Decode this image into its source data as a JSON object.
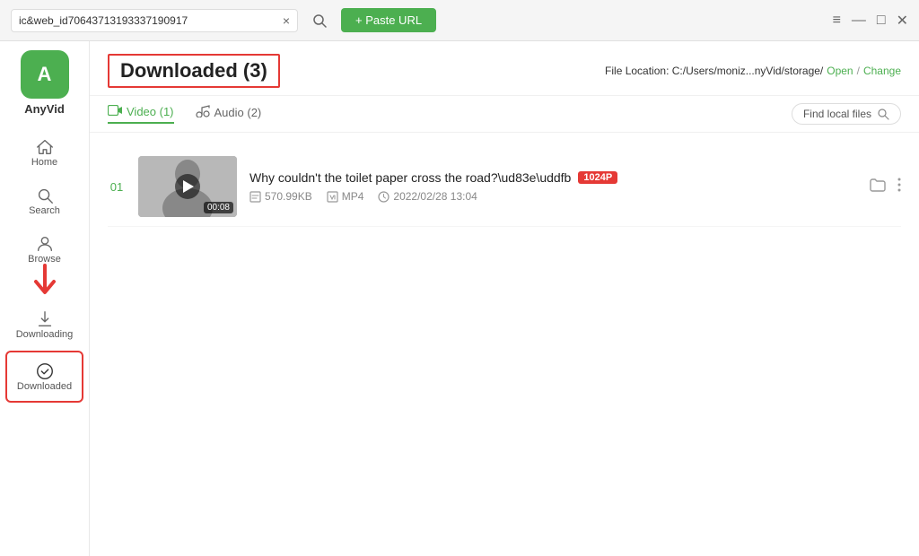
{
  "titlebar": {
    "tab_text": "ic&web_id70643713193337190917",
    "close_icon": "×",
    "search_icon": "⌕",
    "paste_url_label": "+ Paste URL",
    "window_menu": "≡",
    "window_minimize": "—",
    "window_maximize": "□",
    "window_close": "✕"
  },
  "sidebar": {
    "logo_text": "A",
    "app_name": "AnyVid",
    "items": [
      {
        "id": "home",
        "label": "Home",
        "icon": "home"
      },
      {
        "id": "search",
        "label": "Search",
        "icon": "search"
      },
      {
        "id": "browse",
        "label": "Browse",
        "icon": "browse"
      },
      {
        "id": "downloading",
        "label": "Downloading",
        "icon": "downloading"
      },
      {
        "id": "downloaded",
        "label": "Downloaded",
        "icon": "downloaded",
        "active": true
      }
    ]
  },
  "content": {
    "title": "Downloaded (3)",
    "file_location_label": "File Location: C:/Users/moniz...nyVid/storage/",
    "open_label": "Open",
    "separator": "/",
    "change_label": "Change",
    "tabs": [
      {
        "id": "video",
        "label": "Video (1)",
        "active": true
      },
      {
        "id": "audio",
        "label": "Audio (2)",
        "active": false
      }
    ],
    "find_local_label": "Find local files",
    "videos": [
      {
        "number": "01",
        "title": "Why couldn't the toilet paper cross the road?\\ud83e\\uddfb",
        "quality": "1024P",
        "file_size": "570.99KB",
        "format": "MP4",
        "date": "2022/02/28 13:04",
        "duration": "00:08"
      }
    ]
  }
}
